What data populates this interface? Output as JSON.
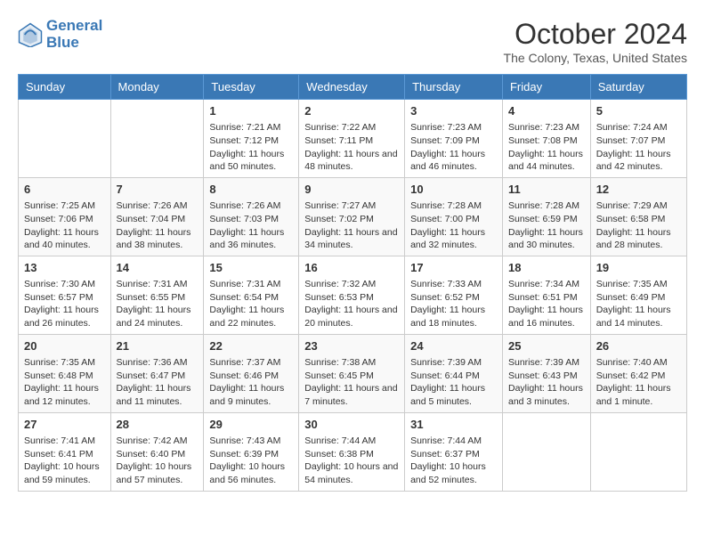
{
  "header": {
    "logo_line1": "General",
    "logo_line2": "Blue",
    "title": "October 2024",
    "subtitle": "The Colony, Texas, United States"
  },
  "calendar": {
    "days_of_week": [
      "Sunday",
      "Monday",
      "Tuesday",
      "Wednesday",
      "Thursday",
      "Friday",
      "Saturday"
    ],
    "weeks": [
      [
        {
          "day": "",
          "info": ""
        },
        {
          "day": "",
          "info": ""
        },
        {
          "day": "1",
          "info": "Sunrise: 7:21 AM\nSunset: 7:12 PM\nDaylight: 11 hours and 50 minutes."
        },
        {
          "day": "2",
          "info": "Sunrise: 7:22 AM\nSunset: 7:11 PM\nDaylight: 11 hours and 48 minutes."
        },
        {
          "day": "3",
          "info": "Sunrise: 7:23 AM\nSunset: 7:09 PM\nDaylight: 11 hours and 46 minutes."
        },
        {
          "day": "4",
          "info": "Sunrise: 7:23 AM\nSunset: 7:08 PM\nDaylight: 11 hours and 44 minutes."
        },
        {
          "day": "5",
          "info": "Sunrise: 7:24 AM\nSunset: 7:07 PM\nDaylight: 11 hours and 42 minutes."
        }
      ],
      [
        {
          "day": "6",
          "info": "Sunrise: 7:25 AM\nSunset: 7:06 PM\nDaylight: 11 hours and 40 minutes."
        },
        {
          "day": "7",
          "info": "Sunrise: 7:26 AM\nSunset: 7:04 PM\nDaylight: 11 hours and 38 minutes."
        },
        {
          "day": "8",
          "info": "Sunrise: 7:26 AM\nSunset: 7:03 PM\nDaylight: 11 hours and 36 minutes."
        },
        {
          "day": "9",
          "info": "Sunrise: 7:27 AM\nSunset: 7:02 PM\nDaylight: 11 hours and 34 minutes."
        },
        {
          "day": "10",
          "info": "Sunrise: 7:28 AM\nSunset: 7:00 PM\nDaylight: 11 hours and 32 minutes."
        },
        {
          "day": "11",
          "info": "Sunrise: 7:28 AM\nSunset: 6:59 PM\nDaylight: 11 hours and 30 minutes."
        },
        {
          "day": "12",
          "info": "Sunrise: 7:29 AM\nSunset: 6:58 PM\nDaylight: 11 hours and 28 minutes."
        }
      ],
      [
        {
          "day": "13",
          "info": "Sunrise: 7:30 AM\nSunset: 6:57 PM\nDaylight: 11 hours and 26 minutes."
        },
        {
          "day": "14",
          "info": "Sunrise: 7:31 AM\nSunset: 6:55 PM\nDaylight: 11 hours and 24 minutes."
        },
        {
          "day": "15",
          "info": "Sunrise: 7:31 AM\nSunset: 6:54 PM\nDaylight: 11 hours and 22 minutes."
        },
        {
          "day": "16",
          "info": "Sunrise: 7:32 AM\nSunset: 6:53 PM\nDaylight: 11 hours and 20 minutes."
        },
        {
          "day": "17",
          "info": "Sunrise: 7:33 AM\nSunset: 6:52 PM\nDaylight: 11 hours and 18 minutes."
        },
        {
          "day": "18",
          "info": "Sunrise: 7:34 AM\nSunset: 6:51 PM\nDaylight: 11 hours and 16 minutes."
        },
        {
          "day": "19",
          "info": "Sunrise: 7:35 AM\nSunset: 6:49 PM\nDaylight: 11 hours and 14 minutes."
        }
      ],
      [
        {
          "day": "20",
          "info": "Sunrise: 7:35 AM\nSunset: 6:48 PM\nDaylight: 11 hours and 12 minutes."
        },
        {
          "day": "21",
          "info": "Sunrise: 7:36 AM\nSunset: 6:47 PM\nDaylight: 11 hours and 11 minutes."
        },
        {
          "day": "22",
          "info": "Sunrise: 7:37 AM\nSunset: 6:46 PM\nDaylight: 11 hours and 9 minutes."
        },
        {
          "day": "23",
          "info": "Sunrise: 7:38 AM\nSunset: 6:45 PM\nDaylight: 11 hours and 7 minutes."
        },
        {
          "day": "24",
          "info": "Sunrise: 7:39 AM\nSunset: 6:44 PM\nDaylight: 11 hours and 5 minutes."
        },
        {
          "day": "25",
          "info": "Sunrise: 7:39 AM\nSunset: 6:43 PM\nDaylight: 11 hours and 3 minutes."
        },
        {
          "day": "26",
          "info": "Sunrise: 7:40 AM\nSunset: 6:42 PM\nDaylight: 11 hours and 1 minute."
        }
      ],
      [
        {
          "day": "27",
          "info": "Sunrise: 7:41 AM\nSunset: 6:41 PM\nDaylight: 10 hours and 59 minutes."
        },
        {
          "day": "28",
          "info": "Sunrise: 7:42 AM\nSunset: 6:40 PM\nDaylight: 10 hours and 57 minutes."
        },
        {
          "day": "29",
          "info": "Sunrise: 7:43 AM\nSunset: 6:39 PM\nDaylight: 10 hours and 56 minutes."
        },
        {
          "day": "30",
          "info": "Sunrise: 7:44 AM\nSunset: 6:38 PM\nDaylight: 10 hours and 54 minutes."
        },
        {
          "day": "31",
          "info": "Sunrise: 7:44 AM\nSunset: 6:37 PM\nDaylight: 10 hours and 52 minutes."
        },
        {
          "day": "",
          "info": ""
        },
        {
          "day": "",
          "info": ""
        }
      ]
    ]
  }
}
